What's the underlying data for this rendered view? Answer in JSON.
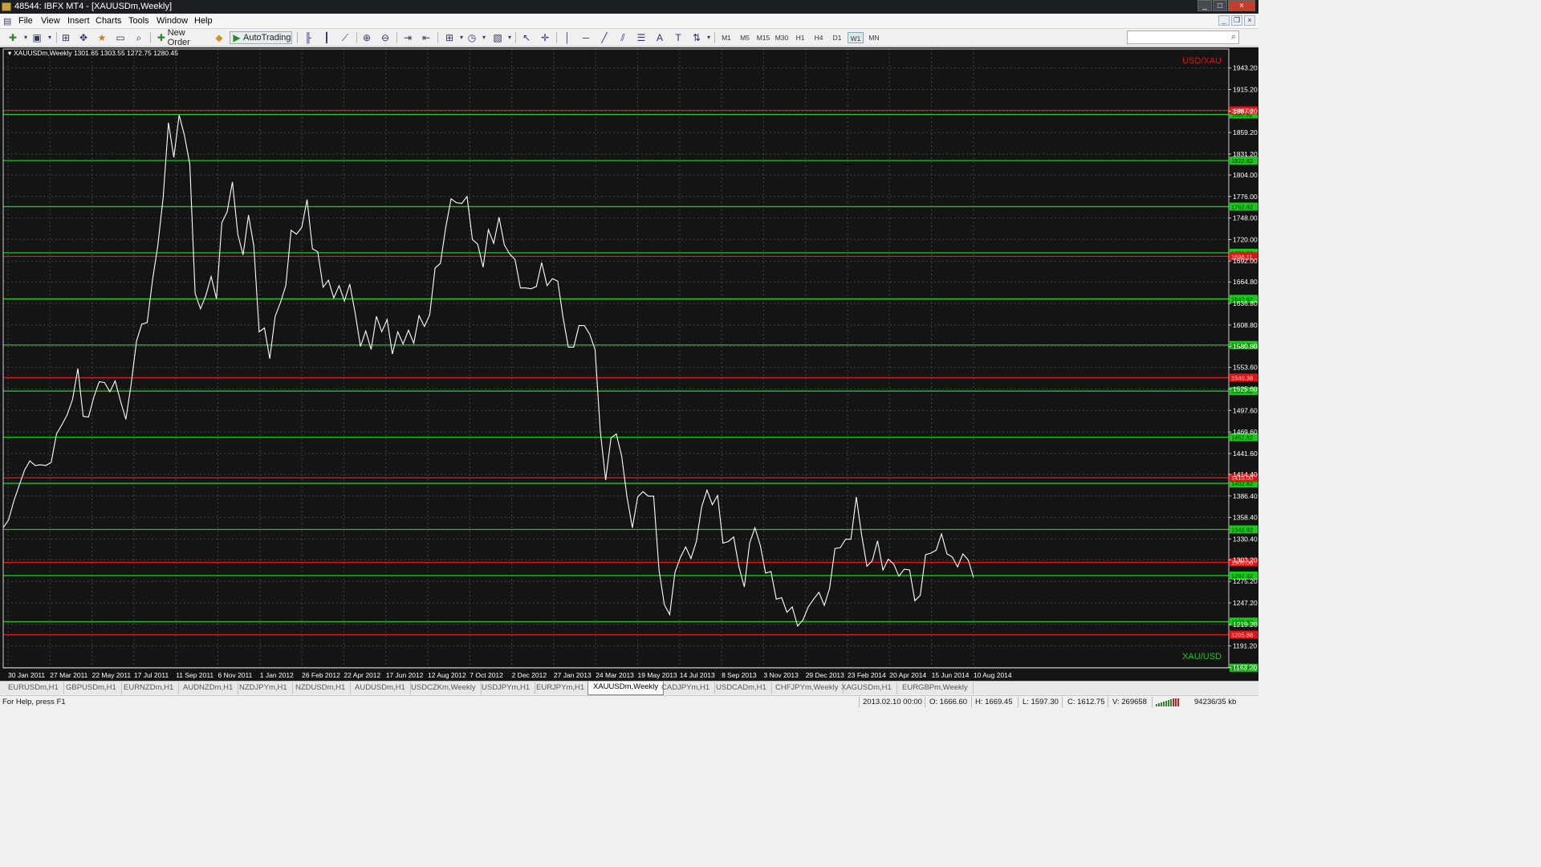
{
  "window": {
    "title": "48544: IBFX MT4 - [XAUUSDm,Weekly]",
    "controls": [
      "_",
      "□",
      "×"
    ]
  },
  "menu": [
    "File",
    "View",
    "Insert",
    "Charts",
    "Tools",
    "Window",
    "Help"
  ],
  "toolbar": {
    "new_order": "New Order",
    "autotrading": "AutoTrading",
    "timeframes": [
      "M1",
      "M5",
      "M15",
      "M30",
      "H1",
      "H4",
      "D1",
      "W1",
      "MN"
    ],
    "active_timeframe": "W1"
  },
  "chart": {
    "header": "XAUUSDm,Weekly  1301.65 1303.55 1272.75 1280.45",
    "label_top": "USD/XAU",
    "label_bottom": "XAU/USD",
    "colors": {
      "background": "#141414",
      "line": "#ffffff",
      "green_level": "#19c819",
      "red_level": "#e01414",
      "grid": "#3c4a3c",
      "axis": "#ffffff"
    }
  },
  "chart_data": {
    "type": "line",
    "symbol": "XAUUSDm",
    "timeframe": "Weekly",
    "ohlc_header": {
      "open": 1301.65,
      "high": 1303.55,
      "low": 1272.75,
      "close": 1280.45
    },
    "ylim": [
      1162.6,
      1968.0
    ],
    "y_ticks": [
      1943.2,
      1915.2,
      1887.2,
      1859.2,
      1831.2,
      1804.0,
      1776.0,
      1748.0,
      1720.0,
      1692.0,
      1664.8,
      1636.8,
      1608.8,
      1580.8,
      1553.6,
      1525.6,
      1497.6,
      1469.6,
      1441.6,
      1414.4,
      1386.4,
      1358.4,
      1330.4,
      1303.2,
      1275.2,
      1247.2,
      1219.2,
      1191.2,
      1163.2
    ],
    "x_ticks": [
      "30 Jan 2011",
      "27 Mar 2011",
      "22 May 2011",
      "17 Jul 2011",
      "11 Sep 2011",
      "6 Nov 2011",
      "1 Jan 2012",
      "26 Feb 2012",
      "22 Apr 2012",
      "17 Jun 2012",
      "12 Aug 2012",
      "7 Oct 2012",
      "2 Dec 2012",
      "27 Jan 2013",
      "24 Mar 2013",
      "19 May 2013",
      "14 Jul 2013",
      "8 Sep 2013",
      "3 Nov 2013",
      "29 Dec 2013",
      "23 Feb 2014",
      "20 Apr 2014",
      "15 Jun 2014",
      "10 Aug 2014"
    ],
    "green_levels": [
      1882.82,
      1822.82,
      1762.82,
      1702.82,
      1642.82,
      1582.82,
      1522.82,
      1462.82,
      1402.82,
      1342.82,
      1282.82,
      1222.82,
      1162.82
    ],
    "red_levels": [
      1888.06,
      1698.11,
      1540.38,
      1410.0,
      1300.0,
      1205.88
    ],
    "price_series": [
      [
        1,
        1345
      ],
      [
        2,
        1355
      ],
      [
        3,
        1380
      ],
      [
        4,
        1400
      ],
      [
        5,
        1420
      ],
      [
        6,
        1432
      ],
      [
        7,
        1426
      ],
      [
        8,
        1427
      ],
      [
        9,
        1426
      ],
      [
        10,
        1430
      ],
      [
        11,
        1467
      ],
      [
        12,
        1479
      ],
      [
        13,
        1492
      ],
      [
        14,
        1512
      ],
      [
        15,
        1552
      ],
      [
        16,
        1490
      ],
      [
        17,
        1489
      ],
      [
        18,
        1515
      ],
      [
        19,
        1535
      ],
      [
        20,
        1534
      ],
      [
        21,
        1522
      ],
      [
        22,
        1536
      ],
      [
        23,
        1510
      ],
      [
        24,
        1486
      ],
      [
        25,
        1532
      ],
      [
        26,
        1588
      ],
      [
        27,
        1610
      ],
      [
        28,
        1612
      ],
      [
        29,
        1667
      ],
      [
        30,
        1712
      ],
      [
        31,
        1775
      ],
      [
        32,
        1872
      ],
      [
        33,
        1827
      ],
      [
        34,
        1882
      ],
      [
        35,
        1855
      ],
      [
        36,
        1818
      ],
      [
        37,
        1650
      ],
      [
        38,
        1630
      ],
      [
        39,
        1647
      ],
      [
        40,
        1672
      ],
      [
        41,
        1643
      ],
      [
        42,
        1742
      ],
      [
        43,
        1756
      ],
      [
        44,
        1795
      ],
      [
        45,
        1727
      ],
      [
        46,
        1700
      ],
      [
        47,
        1752
      ],
      [
        48,
        1712
      ],
      [
        49,
        1600
      ],
      [
        50,
        1605
      ],
      [
        51,
        1565
      ],
      [
        52,
        1620
      ],
      [
        53,
        1638
      ],
      [
        54,
        1660
      ],
      [
        55,
        1732
      ],
      [
        56,
        1727
      ],
      [
        57,
        1736
      ],
      [
        58,
        1772
      ],
      [
        59,
        1708
      ],
      [
        60,
        1704
      ],
      [
        61,
        1658
      ],
      [
        62,
        1667
      ],
      [
        63,
        1644
      ],
      [
        64,
        1660
      ],
      [
        65,
        1640
      ],
      [
        66,
        1662
      ],
      [
        67,
        1625
      ],
      [
        68,
        1581
      ],
      [
        69,
        1601
      ],
      [
        70,
        1577
      ],
      [
        71,
        1620
      ],
      [
        72,
        1600
      ],
      [
        73,
        1616
      ],
      [
        74,
        1571
      ],
      [
        75,
        1600
      ],
      [
        76,
        1584
      ],
      [
        77,
        1602
      ],
      [
        78,
        1585
      ],
      [
        79,
        1621
      ],
      [
        80,
        1607
      ],
      [
        81,
        1622
      ],
      [
        82,
        1683
      ],
      [
        83,
        1689
      ],
      [
        84,
        1736
      ],
      [
        85,
        1773
      ],
      [
        86,
        1768
      ],
      [
        87,
        1767
      ],
      [
        88,
        1776
      ],
      [
        89,
        1720
      ],
      [
        90,
        1714
      ],
      [
        91,
        1684
      ],
      [
        92,
        1733
      ],
      [
        93,
        1715
      ],
      [
        94,
        1749
      ],
      [
        95,
        1713
      ],
      [
        96,
        1701
      ],
      [
        97,
        1694
      ],
      [
        98,
        1657
      ],
      [
        99,
        1657
      ],
      [
        100,
        1656
      ],
      [
        101,
        1659
      ],
      [
        102,
        1690
      ],
      [
        103,
        1660
      ],
      [
        104,
        1669
      ],
      [
        105,
        1666
      ],
      [
        106,
        1619
      ],
      [
        107,
        1580
      ],
      [
        108,
        1580
      ],
      [
        109,
        1608
      ],
      [
        110,
        1608
      ],
      [
        111,
        1597
      ],
      [
        112,
        1577
      ],
      [
        113,
        1470
      ],
      [
        114,
        1407
      ],
      [
        115,
        1462
      ],
      [
        116,
        1467
      ],
      [
        117,
        1438
      ],
      [
        118,
        1385
      ],
      [
        119,
        1345
      ],
      [
        120,
        1385
      ],
      [
        121,
        1392
      ],
      [
        122,
        1386
      ],
      [
        123,
        1386
      ],
      [
        124,
        1290
      ],
      [
        125,
        1245
      ],
      [
        126,
        1232
      ],
      [
        127,
        1287
      ],
      [
        128,
        1306
      ],
      [
        129,
        1320
      ],
      [
        130,
        1305
      ],
      [
        131,
        1327
      ],
      [
        132,
        1372
      ],
      [
        133,
        1394
      ],
      [
        134,
        1375
      ],
      [
        135,
        1387
      ],
      [
        136,
        1325
      ],
      [
        137,
        1327
      ],
      [
        138,
        1333
      ],
      [
        139,
        1294
      ],
      [
        140,
        1268
      ],
      [
        141,
        1325
      ],
      [
        142,
        1345
      ],
      [
        143,
        1322
      ],
      [
        144,
        1286
      ],
      [
        145,
        1288
      ],
      [
        146,
        1252
      ],
      [
        147,
        1254
      ],
      [
        148,
        1235
      ],
      [
        149,
        1242
      ],
      [
        150,
        1217
      ],
      [
        151,
        1225
      ],
      [
        152,
        1242
      ],
      [
        153,
        1252
      ],
      [
        154,
        1261
      ],
      [
        155,
        1244
      ],
      [
        156,
        1266
      ],
      [
        157,
        1318
      ],
      [
        158,
        1319
      ],
      [
        159,
        1330
      ],
      [
        160,
        1330
      ],
      [
        161,
        1385
      ],
      [
        162,
        1336
      ],
      [
        163,
        1295
      ],
      [
        164,
        1302
      ],
      [
        165,
        1328
      ],
      [
        166,
        1290
      ],
      [
        167,
        1304
      ],
      [
        168,
        1298
      ],
      [
        169,
        1282
      ],
      [
        170,
        1291
      ],
      [
        171,
        1290
      ],
      [
        172,
        1250
      ],
      [
        173,
        1257
      ],
      [
        174,
        1310
      ],
      [
        175,
        1312
      ],
      [
        176,
        1316
      ],
      [
        177,
        1337
      ],
      [
        178,
        1311
      ],
      [
        179,
        1307
      ],
      [
        180,
        1294
      ],
      [
        181,
        1311
      ],
      [
        182,
        1303
      ],
      [
        183,
        1280
      ]
    ]
  },
  "tabs": [
    "EURUSDm,H1",
    "GBPUSDm,H1",
    "EURNZDm,H1",
    "AUDNZDm,H1",
    "NZDJPYm,H1",
    "NZDUSDm,H1",
    "AUDUSDm,H1",
    "USDCZKm,Weekly",
    "USDJPYm,H1",
    "EURJPYm,H1",
    "XAUUSDm,Weekly",
    "CADJPYm,H1",
    "USDCADm,H1",
    "CHFJPYm,Weekly",
    "XAGUSDm,H1",
    "EURGBPm,Weekly"
  ],
  "active_tab": "XAUUSDm,Weekly",
  "status": {
    "help": "For Help, press F1",
    "datetime": "2013.02.10 00:00",
    "open": "O: 1666.60",
    "high": "H: 1669.45",
    "low": "L: 1597.30",
    "close": "C: 1612.75",
    "volume": "V: 269658",
    "traffic": "94236/35 kb"
  }
}
